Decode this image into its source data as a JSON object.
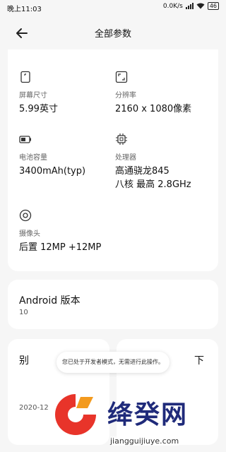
{
  "status_bar": {
    "time": "晚上11:03",
    "network_speed": "0.0K/s",
    "battery": "46"
  },
  "header": {
    "title": "全部参数",
    "back_icon": "arrow-left-icon"
  },
  "specs": [
    {
      "icon": "screen-size-icon",
      "label": "屏幕尺寸",
      "value": "5.99英寸"
    },
    {
      "icon": "resolution-icon",
      "label": "分辨率",
      "value": "2160 x 1080像素"
    },
    {
      "icon": "battery-capacity-icon",
      "label": "电池容量",
      "value": "3400mAh(typ)"
    },
    {
      "icon": "processor-icon",
      "label": "处理器",
      "value": "高通骁龙845",
      "value2": "八核 最高 2.8GHz"
    },
    {
      "icon": "camera-icon",
      "label": "摄像头",
      "value": "后置 12MP +12MP"
    }
  ],
  "android": {
    "label": "Android 版本",
    "value": "10"
  },
  "bottom_cards": {
    "left_label": "别",
    "left_value": "2020-12",
    "right_label": "下"
  },
  "toast": {
    "text": "您已处于开发者模式，无需进行此操作。"
  },
  "watermark": {
    "brand": "绛癸网",
    "url": "jiangguijiuye.com"
  },
  "colors": {
    "background": "#f6f6f6",
    "card": "#ffffff",
    "watermark_blue": "#1f2a7a",
    "watermark_red": "#e8342a",
    "watermark_orange": "#f39a1e"
  }
}
